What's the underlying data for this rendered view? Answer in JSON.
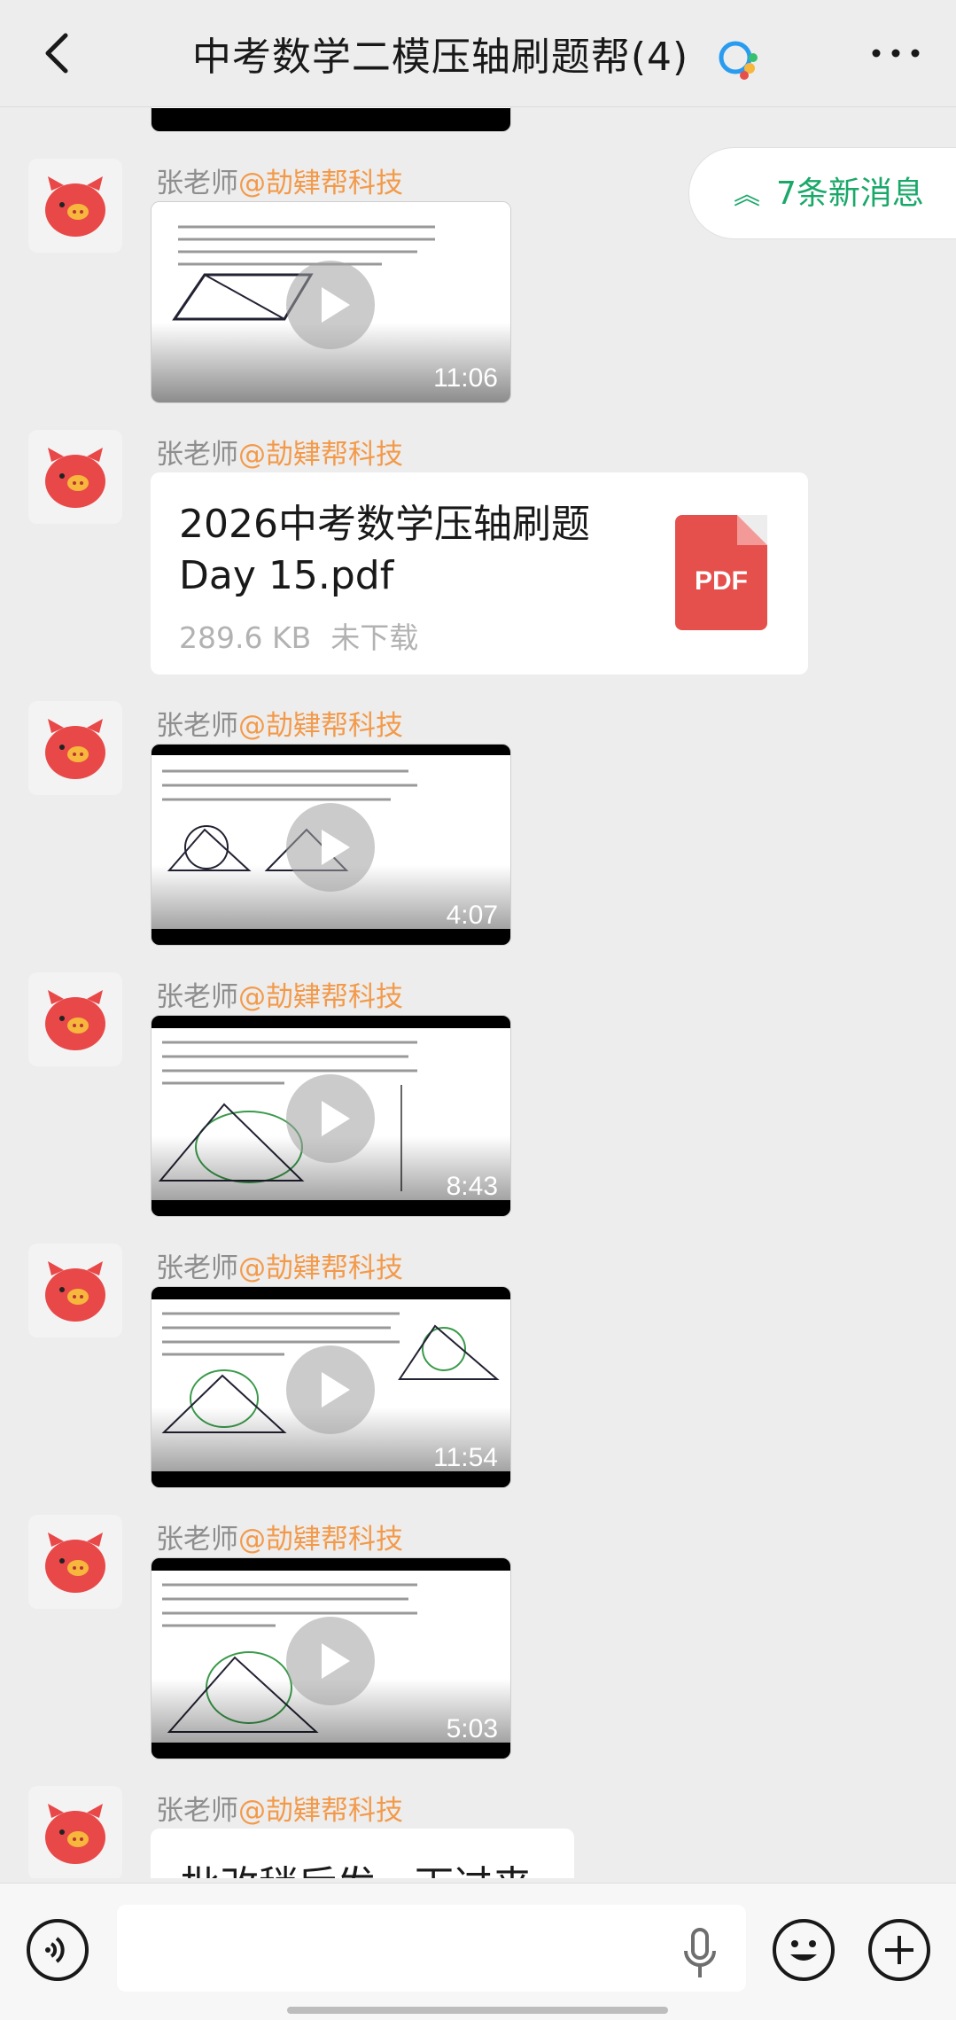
{
  "header": {
    "title": "中考数学二模压轴刷题帮(4)",
    "back_icon": "chevron-left-icon",
    "more_icon": "more-dots-icon"
  },
  "new_messages": {
    "label": "7条新消息",
    "icon": "double-chevron-up-icon",
    "color": "#1aa869"
  },
  "messages": [
    {
      "sender": "张老师",
      "org": "@劼肄帮科技",
      "type": "video",
      "duration": "11:06"
    },
    {
      "sender": "张老师",
      "org": "@劼肄帮科技",
      "type": "file",
      "file_name": "2026中考数学压轴刷题Day 15.pdf",
      "file_size": "289.6 KB",
      "file_status": "未下载",
      "file_badge": "PDF"
    },
    {
      "sender": "张老师",
      "org": "@劼肄帮科技",
      "type": "video",
      "duration": "4:07"
    },
    {
      "sender": "张老师",
      "org": "@劼肄帮科技",
      "type": "video",
      "duration": "8:43"
    },
    {
      "sender": "张老师",
      "org": "@劼肄帮科技",
      "type": "video",
      "duration": "11:54"
    },
    {
      "sender": "张老师",
      "org": "@劼肄帮科技",
      "type": "video",
      "duration": "5:03"
    },
    {
      "sender": "张老师",
      "org": "@劼肄帮科技",
      "type": "text",
      "text": "批改稍后发一下过来"
    }
  ],
  "input_bar": {
    "voice_icon": "voice-toggle-icon",
    "mic_icon": "microphone-icon",
    "emoji_icon": "emoji-icon",
    "plus_icon": "plus-icon"
  },
  "colors": {
    "background": "#ededed",
    "org": "#f39a4a",
    "pdf": "#e5504c"
  }
}
